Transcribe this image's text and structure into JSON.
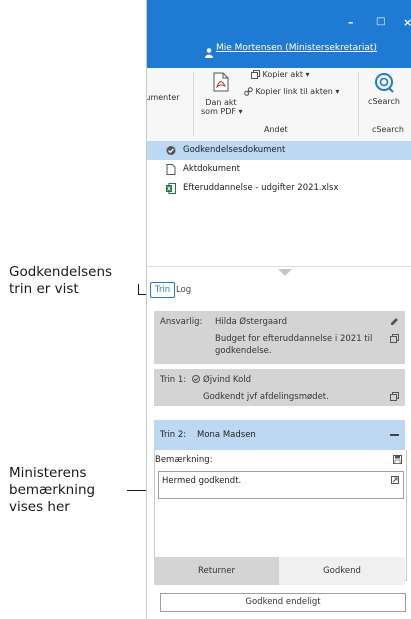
{
  "annotations": {
    "steps_label_line1": "Godkendelsens",
    "steps_label_line2": "trin er vist",
    "remark_label_line1": "Ministerens",
    "remark_label_line2": "bemærkning",
    "remark_label_line3": "vises her"
  },
  "titlebar": {
    "user_name": "Mie Mortensen (Ministersekretariat)",
    "minimize_glyph": "–",
    "maximize_glyph": "□",
    "close_glyph": "×"
  },
  "ribbon": {
    "partial_left_label": "kumenter",
    "pdf_label_line1": "Dan akt",
    "pdf_label_line2": "som PDF ▾",
    "copy_act": "Kopier akt ▾",
    "copy_link": "Kopier link til akten ▾",
    "group_andet": "Andet",
    "csearch_label": "cSearch",
    "group_csearch": "cSearch"
  },
  "documents": [
    {
      "name": "Godkendelsesdokument",
      "icon": "check-circle-icon",
      "selected": true
    },
    {
      "name": "Aktdokument",
      "icon": "document-icon",
      "selected": false
    },
    {
      "name": "Efteruddannelse - udgifter 2021.xlsx",
      "icon": "excel-icon",
      "selected": false
    }
  ],
  "tabs": {
    "trin": "Trin",
    "log": "Log"
  },
  "responsible_card": {
    "label": "Ansvarlig:",
    "name": "Hilda Østergaard",
    "text_line1": "Budget for efteruddannelse i 2021 til",
    "text_line2": "godkendelse."
  },
  "step1_card": {
    "label": "Trin 1:",
    "name": "Øjvind Kold",
    "text": "Godkendt jvf afdelingsmødet."
  },
  "step2": {
    "label": "Trin 2:",
    "name": "Mona Madsen",
    "remark_label": "Bemærkning:",
    "remark_text": "Hermed godkendt."
  },
  "buttons": {
    "return": "Returner",
    "approve": "Godkend",
    "approve_final": "Godkend endeligt"
  },
  "colors": {
    "accent": "#1f7ad3",
    "selected_row": "#bcd8f2",
    "card_gray": "#d4d4d4"
  }
}
